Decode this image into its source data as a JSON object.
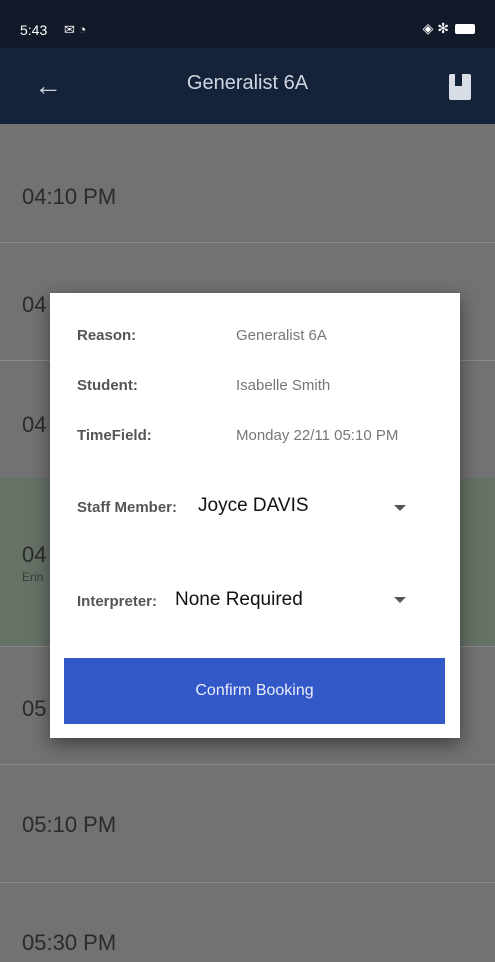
{
  "status_bar": {
    "time": "5:43",
    "left_icons": "✉ ◔",
    "right_icons": "◈ ✻"
  },
  "app_bar": {
    "title": "Generalist 6A",
    "back_icon": "←"
  },
  "slots": [
    {
      "time": "04:10 PM"
    },
    {
      "time": "04"
    },
    {
      "time": "04"
    },
    {
      "time": "04",
      "sub": "Erin"
    },
    {
      "time": "05"
    },
    {
      "time": "05:10 PM"
    },
    {
      "time": "05:30 PM"
    }
  ],
  "modal": {
    "reason_label": "Reason:",
    "reason_value": "Generalist 6A",
    "student_label": "Student:",
    "student_value": "Isabelle Smith",
    "time_label": "TimeField:",
    "time_value": "Monday 22/11 05:10 PM",
    "staff_label": "Staff Member:",
    "staff_value": "Joyce DAVIS",
    "interpreter_label": "Interpreter:",
    "interpreter_value": "None Required",
    "confirm_label": "Confirm Booking"
  }
}
